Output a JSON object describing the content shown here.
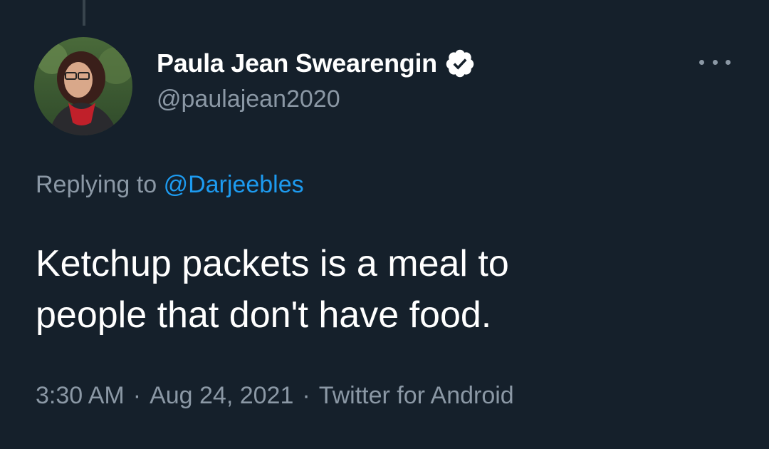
{
  "author": {
    "display_name": "Paula Jean Swearengin",
    "handle": "@paulajean2020",
    "verified_icon": "verified-badge-icon",
    "avatar_icon": "avatar"
  },
  "reply": {
    "prefix": "Replying to",
    "mention": "@Darjeebles"
  },
  "tweet": {
    "line1": "Ketchup packets is a meal to",
    "line2": "people that don't have food."
  },
  "meta": {
    "time": "3:30 AM",
    "separator": "·",
    "date": "Aug 24, 2021",
    "source": "Twitter for Android"
  },
  "more_icon": "more-options-icon",
  "colors": {
    "background": "#15202b",
    "primary_text": "#ffffff",
    "secondary_text": "#8b98a5",
    "link": "#1d9bf0",
    "thread_line": "#38444d"
  }
}
